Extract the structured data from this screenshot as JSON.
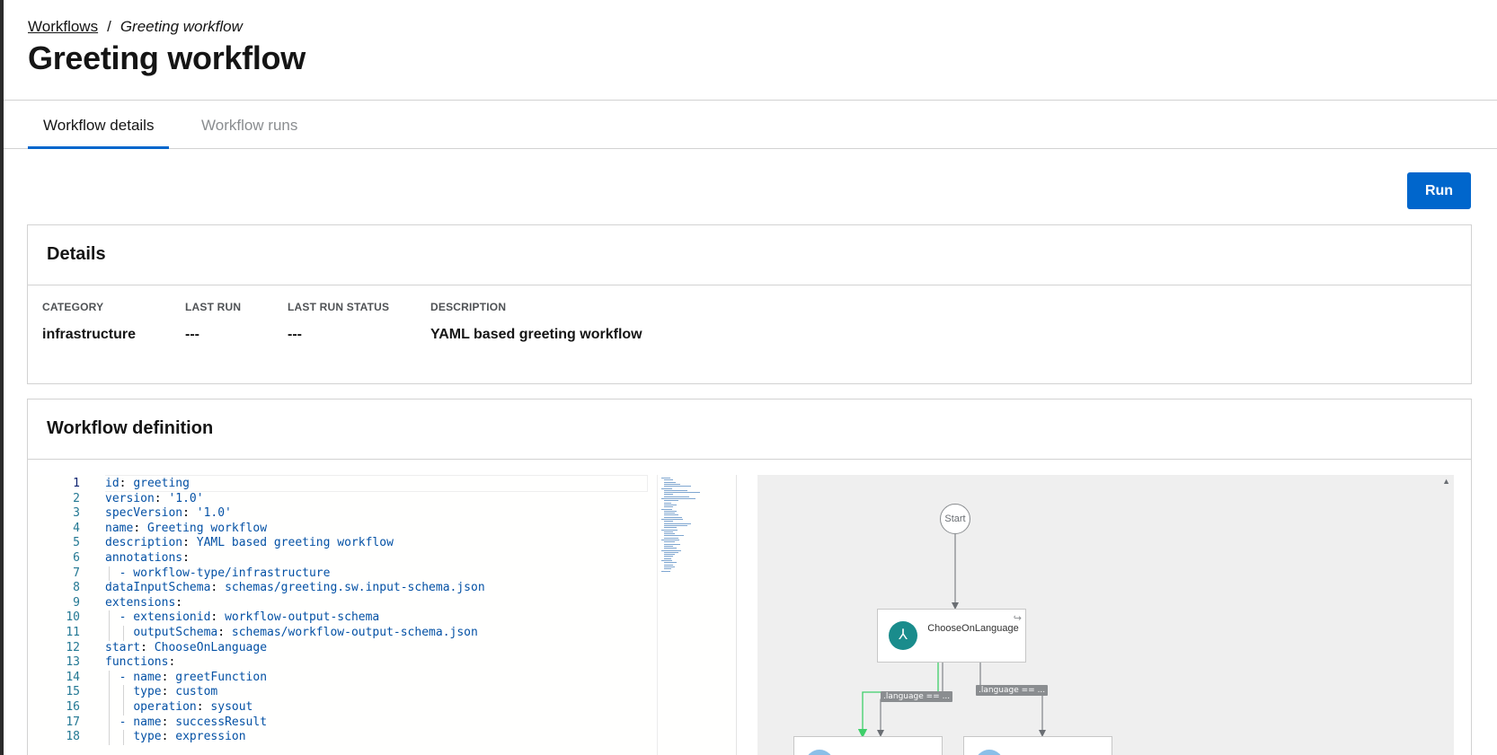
{
  "breadcrumb": {
    "parent": "Workflows",
    "separator": "/",
    "current": "Greeting workflow"
  },
  "page_title": "Greeting workflow",
  "tabs": [
    {
      "label": "Workflow details",
      "active": true
    },
    {
      "label": "Workflow runs",
      "active": false
    }
  ],
  "run_button": "Run",
  "details": {
    "title": "Details",
    "fields": [
      {
        "label": "CATEGORY",
        "value": "infrastructure"
      },
      {
        "label": "LAST RUN",
        "value": "---"
      },
      {
        "label": "LAST RUN STATUS",
        "value": "---"
      },
      {
        "label": "DESCRIPTION",
        "value": "YAML based greeting workflow"
      }
    ]
  },
  "definition": {
    "title": "Workflow definition",
    "active_line": 1,
    "lines": [
      {
        "n": "1",
        "key": "id",
        "val": "greeting"
      },
      {
        "n": "2",
        "key": "version",
        "val": "'1.0'"
      },
      {
        "n": "3",
        "key": "specVersion",
        "val": "'1.0'"
      },
      {
        "n": "4",
        "key": "name",
        "val": "Greeting workflow"
      },
      {
        "n": "5",
        "key": "description",
        "val": "YAML based greeting workflow"
      },
      {
        "n": "6",
        "key": "annotations",
        "val": ""
      },
      {
        "n": "7",
        "key": "",
        "val": "- workflow-type/infrastructure"
      },
      {
        "n": "8",
        "key": "dataInputSchema",
        "val": "schemas/greeting.sw.input-schema.json"
      },
      {
        "n": "9",
        "key": "extensions",
        "val": ""
      },
      {
        "n": "10",
        "key": "- extensionid",
        "val": "workflow-output-schema"
      },
      {
        "n": "11",
        "key": "outputSchema",
        "val": "schemas/workflow-output-schema.json"
      },
      {
        "n": "12",
        "key": "start",
        "val": "ChooseOnLanguage"
      },
      {
        "n": "13",
        "key": "functions",
        "val": ""
      },
      {
        "n": "14",
        "key": "- name",
        "val": "greetFunction"
      },
      {
        "n": "15",
        "key": "type",
        "val": "custom"
      },
      {
        "n": "16",
        "key": "operation",
        "val": "sysout"
      },
      {
        "n": "17",
        "key": "- name",
        "val": "successResult"
      },
      {
        "n": "18",
        "key": "type",
        "val": "expression"
      }
    ]
  },
  "diagram": {
    "start_label": "Start",
    "choose_node_label": "ChooseOnLanguage",
    "edge_labels": [
      ".language == ...",
      ".language == ..."
    ]
  },
  "colors": {
    "primary": "#0066cc",
    "node_icon": "#1a8c8c",
    "edge_active": "#3ecf6a"
  }
}
